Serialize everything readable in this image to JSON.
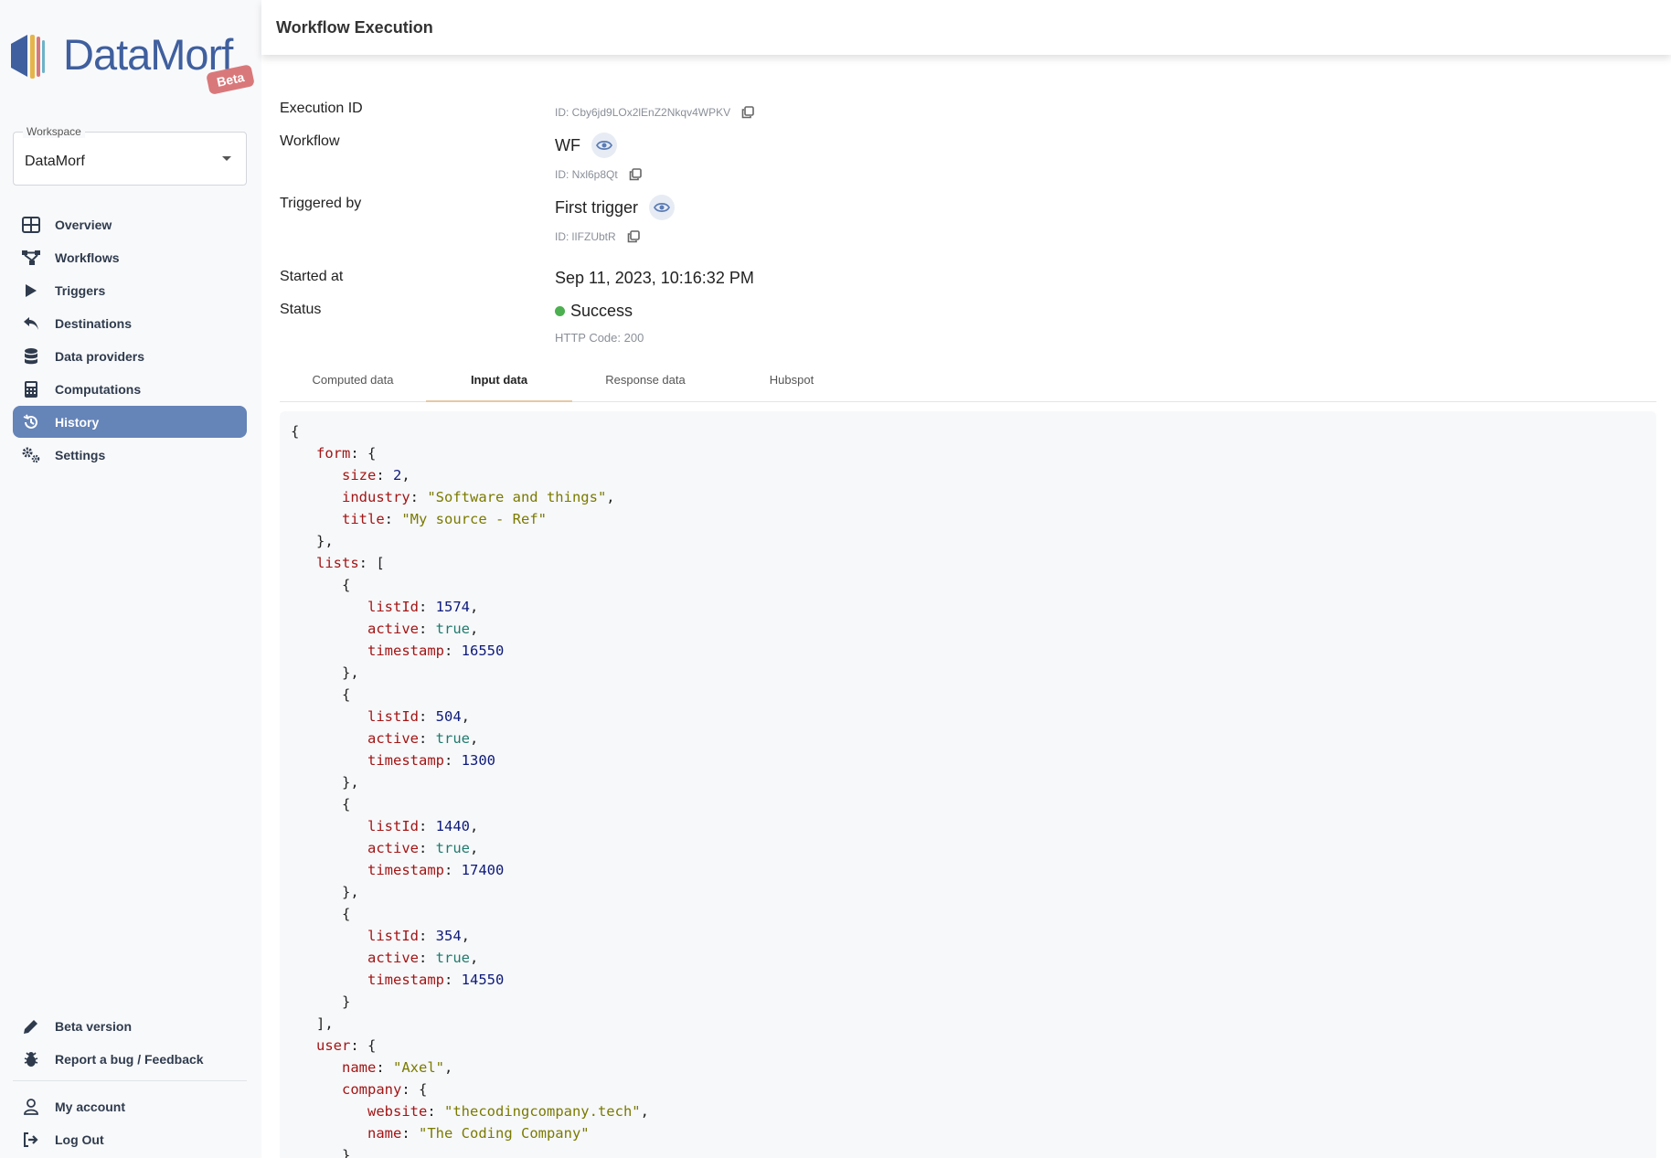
{
  "brand": {
    "name": "DataMorf",
    "badge": "Beta"
  },
  "workspace": {
    "label": "Workspace",
    "value": "DataMorf"
  },
  "nav": {
    "items": [
      {
        "label": "Overview",
        "icon": "grid-icon"
      },
      {
        "label": "Workflows",
        "icon": "flow-icon"
      },
      {
        "label": "Triggers",
        "icon": "play-icon"
      },
      {
        "label": "Destinations",
        "icon": "reply-icon"
      },
      {
        "label": "Data providers",
        "icon": "database-icon"
      },
      {
        "label": "Computations",
        "icon": "calculator-icon"
      },
      {
        "label": "History",
        "icon": "history-icon",
        "active": true
      },
      {
        "label": "Settings",
        "icon": "gears-icon"
      }
    ],
    "bottom": [
      {
        "label": "Beta version",
        "icon": "pencil-icon"
      },
      {
        "label": "Report a bug / Feedback",
        "icon": "bug-icon"
      },
      {
        "label": "My account",
        "icon": "user-icon"
      },
      {
        "label": "Log Out",
        "icon": "logout-icon"
      }
    ]
  },
  "header": {
    "title": "Workflow Execution"
  },
  "details": {
    "execution_id_label": "Execution ID",
    "execution_id": "ID: Cby6jd9LOx2lEnZ2Nkqv4WPKV",
    "workflow_label": "Workflow",
    "workflow_name": "WF",
    "workflow_id": "ID: Nxl6p8Qt",
    "triggered_label": "Triggered by",
    "trigger_name": "First trigger",
    "trigger_id": "ID: lIFZUbtR",
    "started_label": "Started at",
    "started_value": "Sep 11, 2023, 10:16:32 PM",
    "status_label": "Status",
    "status_value": "Success",
    "http_code": "HTTP Code: 200"
  },
  "tabs": [
    {
      "label": "Computed data"
    },
    {
      "label": "Input data",
      "active": true
    },
    {
      "label": "Response data"
    },
    {
      "label": "Hubspot"
    }
  ],
  "input_data": {
    "form": {
      "size": "2",
      "industry": "\"Software and things\"",
      "title": "\"My source - Ref\""
    },
    "lists": [
      {
        "listId": "1574",
        "active": "true",
        "timestamp": "16550"
      },
      {
        "listId": "504",
        "active": "true",
        "timestamp": "1300"
      },
      {
        "listId": "1440",
        "active": "true",
        "timestamp": "17400"
      },
      {
        "listId": "354",
        "active": "true",
        "timestamp": "14550"
      }
    ],
    "user": {
      "name": "\"Axel\"",
      "company": {
        "website": "\"thecodingcompany.tech\"",
        "name": "\"The Coding Company\""
      }
    }
  },
  "colors": {
    "accent": "#6584b8",
    "success": "#4caf50",
    "brand": "#3f5f9e",
    "badge": "#d9787a"
  }
}
